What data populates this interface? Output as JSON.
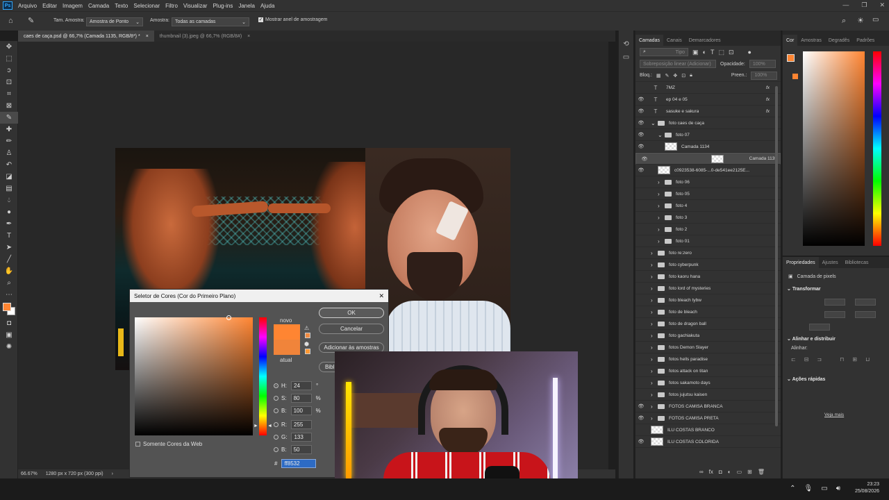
{
  "menubar": {
    "app_logo": "Ps",
    "items": [
      "Arquivo",
      "Editar",
      "Imagem",
      "Camada",
      "Texto",
      "Selecionar",
      "Filtro",
      "Visualizar",
      "Plug-ins",
      "Janela",
      "Ajuda"
    ]
  },
  "options": {
    "sample_size_label": "Tam. Amostra:",
    "sample_size_value": "Amostra de Ponto",
    "sample_label": "Amostra:",
    "sample_value": "Todas as camadas",
    "show_ring_label": "Mostrar anel de amostragem"
  },
  "tabs": [
    {
      "label": "caes de caça.psd @ 66,7% (Camada 1135, RGB/8*) *",
      "close": "×"
    },
    {
      "label": "thumbnail (3).jpeg @ 66,7% (RGB/8#)",
      "close": "×"
    }
  ],
  "status": {
    "zoom": "66.67%",
    "doc_info": "1280 px x 720 px (300 ppi)"
  },
  "layers_panel": {
    "tabs": [
      "Camadas",
      "Canais",
      "Demarcadores"
    ],
    "search_placeholder": "Tipo",
    "blend_mode": "Sobreposição linear (Adicionar)",
    "opacity_label": "Opacidade:",
    "opacity_value": "100%",
    "lock_label": "Bloq.:",
    "fill_label": "Preen.:",
    "fill_value": "100%",
    "layers": [
      {
        "name": "7MZ",
        "kind": "text",
        "visible": false,
        "indent": 0
      },
      {
        "name": "ep 04 e 05",
        "kind": "text",
        "visible": true,
        "indent": 0
      },
      {
        "name": "sasuke e sakura",
        "kind": "text",
        "visible": true,
        "indent": 0
      },
      {
        "name": "foto caes de caça",
        "kind": "folder",
        "visible": true,
        "indent": 0,
        "open": true
      },
      {
        "name": "foto 07",
        "kind": "folder",
        "visible": true,
        "indent": 1,
        "open": true
      },
      {
        "name": "Camada 1134",
        "kind": "pixel",
        "visible": true,
        "indent": 2
      },
      {
        "name": "Camada 1135",
        "kind": "pixel",
        "visible": true,
        "indent": 2,
        "selected": true
      },
      {
        "name": "c0923538-6085-...0-de541ee2125E...",
        "kind": "smart",
        "visible": true,
        "indent": 1
      },
      {
        "name": "foto 06",
        "kind": "folder",
        "visible": false,
        "indent": 1
      },
      {
        "name": "foto 05",
        "kind": "folder",
        "visible": false,
        "indent": 1
      },
      {
        "name": "foto 4",
        "kind": "folder",
        "visible": false,
        "indent": 1
      },
      {
        "name": "foto 3",
        "kind": "folder",
        "visible": false,
        "indent": 1
      },
      {
        "name": "foto 2",
        "kind": "folder",
        "visible": false,
        "indent": 1
      },
      {
        "name": "foto 01",
        "kind": "folder",
        "visible": false,
        "indent": 1
      },
      {
        "name": "foto re:zero",
        "kind": "folder",
        "visible": false,
        "indent": 0
      },
      {
        "name": "foto cyberpunk",
        "kind": "folder",
        "visible": false,
        "indent": 0
      },
      {
        "name": "foto kaoru hana",
        "kind": "folder",
        "visible": false,
        "indent": 0
      },
      {
        "name": "foto lord of mysteries",
        "kind": "folder",
        "visible": false,
        "indent": 0
      },
      {
        "name": "foto bleach tybw",
        "kind": "folder",
        "visible": false,
        "indent": 0
      },
      {
        "name": "foto de bleach",
        "kind": "folder",
        "visible": false,
        "indent": 0
      },
      {
        "name": "foto de dragon ball",
        "kind": "folder",
        "visible": false,
        "indent": 0
      },
      {
        "name": "foto gachiakuta",
        "kind": "folder",
        "visible": false,
        "indent": 0
      },
      {
        "name": "fotos Demon Slayer",
        "kind": "folder",
        "visible": false,
        "indent": 0
      },
      {
        "name": "fotos hells paradise",
        "kind": "folder",
        "visible": false,
        "indent": 0
      },
      {
        "name": "fotos  attack on titan",
        "kind": "folder",
        "visible": false,
        "indent": 0
      },
      {
        "name": "fotos sakamoto days",
        "kind": "folder",
        "visible": false,
        "indent": 0
      },
      {
        "name": "fotos jujutsu kaisen",
        "kind": "folder",
        "visible": false,
        "indent": 0
      },
      {
        "name": "FOTOS CAMISA BRANCA",
        "kind": "folder",
        "visible": true,
        "indent": 0
      },
      {
        "name": "FOTOS CAMISA PRETA",
        "kind": "folder",
        "visible": true,
        "indent": 0
      },
      {
        "name": "ILU COSTAS BRANCO",
        "kind": "pixel",
        "visible": false,
        "indent": 0
      },
      {
        "name": "ILU COSTAS COLORIDA",
        "kind": "pixel",
        "visible": true,
        "indent": 0
      }
    ]
  },
  "color_panel": {
    "tabs": [
      "Cor",
      "Amostras",
      "Degradês",
      "Padrões"
    ]
  },
  "properties_panel": {
    "tabs": [
      "Propriedades",
      "Ajustes",
      "Bibliotecas"
    ],
    "layer_type": "Camada de pixels",
    "transform_title": "Transformar",
    "align_title": "Alinhar e distribuir",
    "align_label": "Alinhar:",
    "quick_actions_title": "Ações rápidas",
    "more_link": "Veja mais"
  },
  "dialog": {
    "title": "Seletor de Cores (Cor do Primeiro Plano)",
    "close": "✕",
    "ok": "OK",
    "cancel": "Cancelar",
    "add_swatches": "Adicionar às amostras",
    "libraries_partial": "Bibl",
    "new_label": "novo",
    "current_label": "atual",
    "web_only": "Somente Cores da Web",
    "h_label": "H:",
    "h_value": "24",
    "h_unit": "°",
    "s_label": "S:",
    "s_value": "80",
    "s_unit": "%",
    "b_label": "B:",
    "b_value": "100",
    "b_unit": "%",
    "r_label": "R:",
    "r_value": "255",
    "g_label": "G:",
    "g_value": "133",
    "bb_label": "B:",
    "bb_value": "50",
    "hex_label": "#",
    "hex_value": "ff8532"
  },
  "taskbar": {
    "time": "23:23",
    "date": "25/08/2026"
  },
  "colors": {
    "foreground": "#ff8532",
    "accent": "#31a8ff"
  }
}
